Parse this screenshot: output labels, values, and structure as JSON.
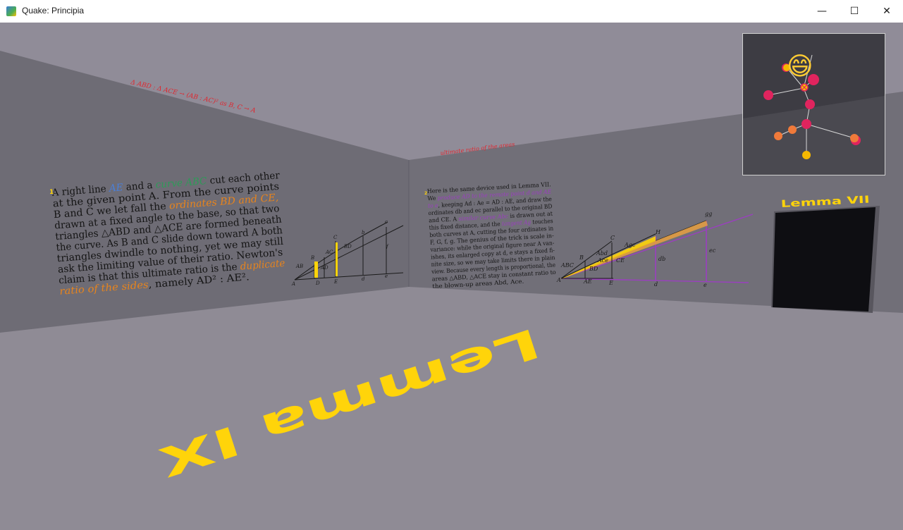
{
  "window": {
    "title": "Quake: Principia",
    "controls": {
      "minimize": "—",
      "maximize": "☐",
      "close": "✕"
    }
  },
  "scene": {
    "floor_label": "Lemma IX",
    "doorway_label": "Lemma VII",
    "red_ceiling_text_left": "Δ ABD : Δ ACE → (AB : AC)² as B, C → A",
    "red_ceiling_text_right": "ultimate ratio of the areas",
    "left_panel": {
      "marker": "1",
      "lines": [
        {
          "parts": [
            {
              "t": "A right line "
            },
            {
              "t": "AE",
              "c": "#4a7fd8"
            },
            {
              "t": " and a "
            },
            {
              "t": "curve ABC",
              "c": "#2e9a58"
            },
            {
              "t": " cut each other"
            }
          ]
        },
        {
          "parts": [
            {
              "t": "at the given point A.  From the curve points"
            }
          ]
        },
        {
          "parts": [
            {
              "t": "B and C we let fall the "
            },
            {
              "t": "ordinates BD and CE,",
              "c": "#e8841c"
            }
          ]
        },
        {
          "parts": [
            {
              "t": "drawn at a fixed angle to the base, so that two"
            }
          ]
        },
        {
          "parts": [
            {
              "t": "triangles △ABD and △ACE are formed beneath"
            }
          ]
        },
        {
          "parts": [
            {
              "t": "the curve.  As B and C slide down toward A both"
            }
          ]
        },
        {
          "parts": [
            {
              "t": "triangles dwindle to nothing, yet we may still"
            }
          ]
        },
        {
          "parts": [
            {
              "t": "ask the limiting value of their ratio.  Newton's"
            }
          ]
        },
        {
          "parts": [
            {
              "t": "claim is that this ultimate ratio is the "
            },
            {
              "t": "duplicate",
              "c": "#e8841c"
            }
          ]
        },
        {
          "parts": [
            {
              "t": "ratio of the sides",
              "c": "#e8841c"
            },
            {
              "t": ", namely AD² : AE²."
            }
          ]
        }
      ],
      "diagram_labels": [
        "A",
        "B",
        "C",
        "D",
        "E",
        "AB",
        "AD",
        "AC",
        "BD",
        "d",
        "e",
        "c",
        "b",
        "f"
      ]
    },
    "right_panel": {
      "marker": "2",
      "lines": [
        {
          "parts": [
            {
              "t": "Here is the same device used in Lemma VII."
            }
          ]
        },
        {
          "parts": [
            {
              "t": "We "
            },
            {
              "t": "produce AD to the remote point d and AE",
              "c": "#9b3fc0"
            }
          ]
        },
        {
          "parts": [
            {
              "t": "to e",
              "c": "#9b3fc0"
            },
            {
              "t": ", keeping Ad : Ae = AD : AE, and draw the"
            }
          ]
        },
        {
          "parts": [
            {
              "t": "ordinates db and ec parallel to the original BD"
            }
          ]
        },
        {
          "parts": [
            {
              "t": "and CE.  A "
            },
            {
              "t": "similar curve Abc",
              "c": "#9b3fc0"
            },
            {
              "t": " is drawn out at"
            }
          ]
        },
        {
          "parts": [
            {
              "t": "this fixed distance, and the "
            },
            {
              "t": "tangent Ag",
              "c": "#9b3fc0"
            },
            {
              "t": " touches"
            }
          ]
        },
        {
          "parts": [
            {
              "t": "both curves at A, cutting the four ordinates in"
            }
          ]
        },
        {
          "parts": [
            {
              "t": "F, G, f, g.  The genius of the trick is scale in-"
            }
          ]
        },
        {
          "parts": [
            {
              "t": "variance: while the original figure near A van-"
            }
          ]
        },
        {
          "parts": [
            {
              "t": "ishes, its enlarged copy at d, e stays a fixed fi-"
            }
          ]
        },
        {
          "parts": [
            {
              "t": "nite size, so we may take limits there in plain"
            }
          ]
        },
        {
          "parts": [
            {
              "t": "view.  Because every length is proportional, the"
            }
          ]
        },
        {
          "parts": [
            {
              "t": "areas △ABD, △ACE stay in constant ratio to"
            }
          ]
        },
        {
          "parts": [
            {
              "t": "the blown-up areas Abd, Ace."
            }
          ]
        }
      ],
      "diagram_labels": [
        "gg",
        "H",
        "C",
        "Agc",
        "B",
        "ABC",
        "Abd",
        "BD",
        "Ace",
        "CE",
        "ec",
        "db",
        "A",
        "AE",
        "E",
        "d",
        "e"
      ]
    }
  },
  "colors": {
    "floor": "#8f8b95",
    "wall_left": "#6e6c75",
    "wall_right": "#716f78",
    "ceiling": "#908c98",
    "accent_yellow": "#ffd40a",
    "accent_orange": "#e8841c",
    "accent_purple": "#9b3fc0",
    "red_text": "#e0262e",
    "doorway": "#0e0e12"
  },
  "minimap": {
    "emoji": "😄",
    "nodes": [
      {
        "c": "#e0245e"
      },
      {
        "c": "#e0245e"
      },
      {
        "c": "#e0245e"
      },
      {
        "c": "#e0245e"
      },
      {
        "c": "#e0245e"
      },
      {
        "c": "#f5b800"
      },
      {
        "c": "#f5b800"
      },
      {
        "c": "#f07a3a"
      },
      {
        "c": "#f07a3a"
      },
      {
        "c": "#e0245e"
      },
      {
        "c": "#f07a3a"
      }
    ]
  }
}
